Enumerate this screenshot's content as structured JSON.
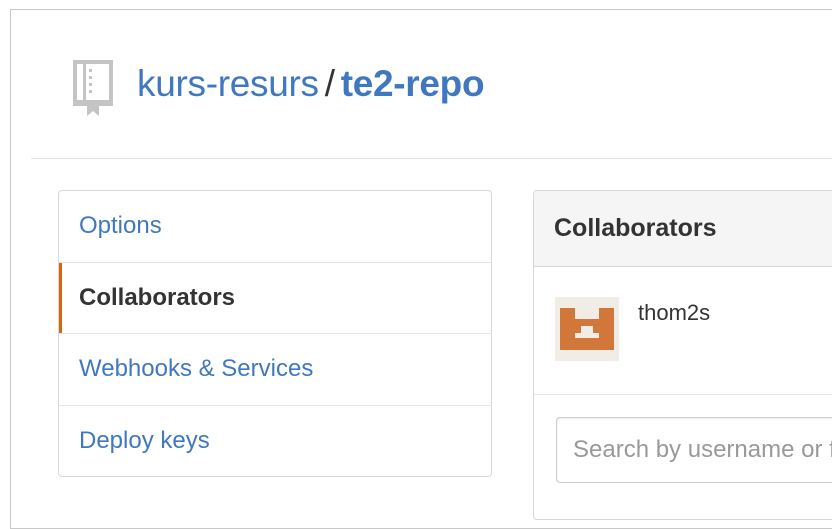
{
  "repo": {
    "owner": "kurs-resurs",
    "separator": "/",
    "name": "te2-repo",
    "icon": "repo-book-icon"
  },
  "menu": {
    "items": [
      {
        "label": "Options",
        "selected": false
      },
      {
        "label": "Collaborators",
        "selected": true
      },
      {
        "label": "Webhooks & Services",
        "selected": false
      },
      {
        "label": "Deploy keys",
        "selected": false
      }
    ]
  },
  "collaborators": {
    "title": "Collaborators",
    "members": [
      {
        "username": "thom2s",
        "avatar_color": "#d2773a"
      }
    ],
    "search": {
      "placeholder": "Search by username or full name",
      "value": ""
    }
  },
  "colors": {
    "link": "#4078c0",
    "selected_accent": "#d26911",
    "text": "#333333"
  }
}
